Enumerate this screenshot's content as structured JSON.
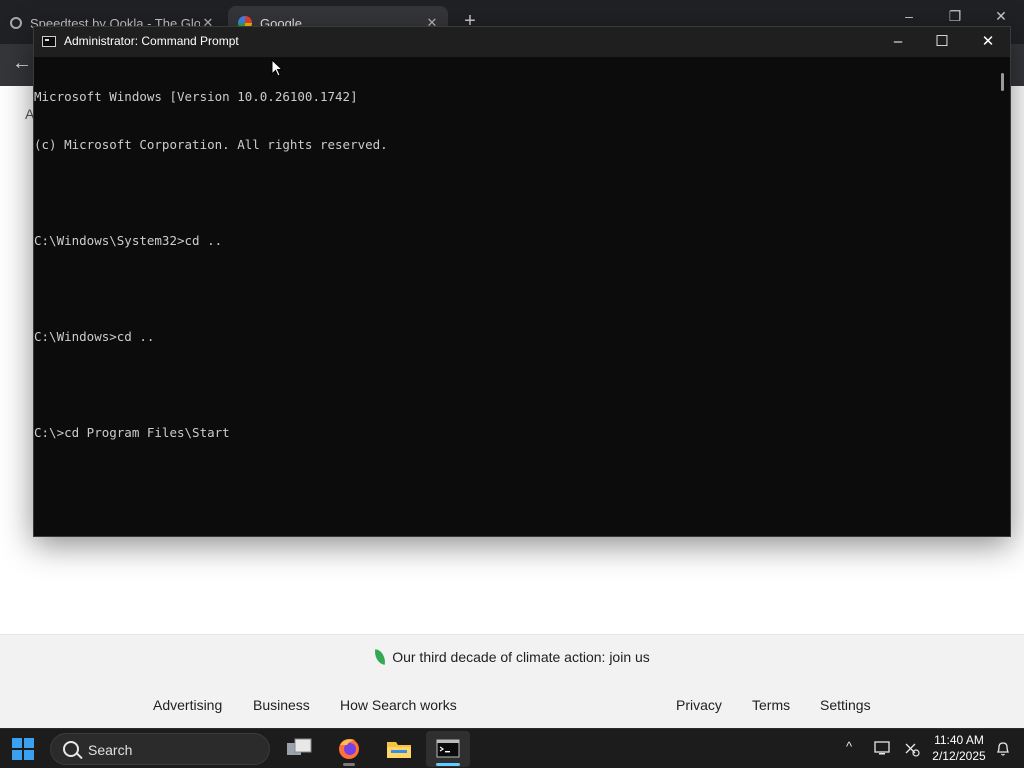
{
  "browser": {
    "tabs": [
      {
        "title": "Speedtest by Ookla - The Global",
        "active": false
      },
      {
        "title": "Google",
        "active": true
      }
    ],
    "page_letter": "A"
  },
  "google_footer": {
    "climate_text": "Our third decade of climate action: join us",
    "left_links": [
      "Advertising",
      "Business",
      "How Search works"
    ],
    "right_links": [
      "Privacy",
      "Terms",
      "Settings"
    ]
  },
  "cmd": {
    "title": "Administrator: Command Prompt",
    "lines": [
      "Microsoft Windows [Version 10.0.26100.1742]",
      "(c) Microsoft Corporation. All rights reserved.",
      "",
      "C:\\Windows\\System32>cd ..",
      "",
      "C:\\Windows>cd ..",
      "",
      "C:\\>cd Program Files\\Start"
    ]
  },
  "taskbar": {
    "search_label": "Search",
    "time": "11:40 AM",
    "date": "2/12/2025",
    "accent": "#60cdff"
  }
}
